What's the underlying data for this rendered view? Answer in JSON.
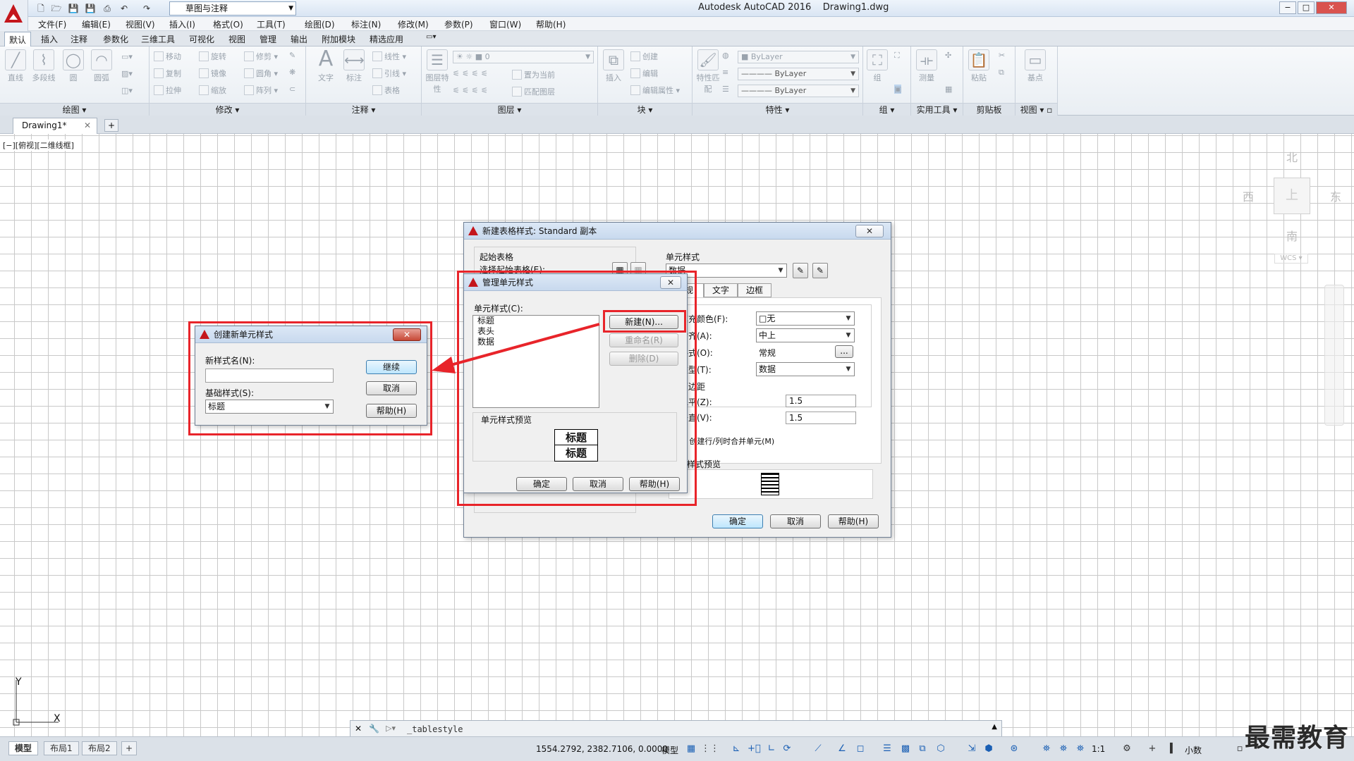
{
  "app": {
    "title": "Autodesk AutoCAD 2016",
    "filename": "Drawing1.dwg",
    "workspace": "草图与注释"
  },
  "menu": [
    "文件(F)",
    "编辑(E)",
    "视图(V)",
    "插入(I)",
    "格式(O)",
    "工具(T)",
    "绘图(D)",
    "标注(N)",
    "修改(M)",
    "参数(P)",
    "窗口(W)",
    "帮助(H)"
  ],
  "ribbon_tabs": [
    "默认",
    "插入",
    "注释",
    "参数化",
    "三维工具",
    "可视化",
    "视图",
    "管理",
    "输出",
    "附加模块",
    "精选应用"
  ],
  "ribbon": {
    "draw": {
      "label": "绘图",
      "line": "直线",
      "polyline": "多段线",
      "circle": "圆",
      "arc": "圆弧"
    },
    "modify": {
      "label": "修改",
      "move": "移动",
      "rotate": "旋转",
      "trim": "修剪",
      "copy": "复制",
      "mirror": "镜像",
      "fillet": "圆角",
      "stretch": "拉伸",
      "scale": "缩放",
      "array": "阵列"
    },
    "annotation": {
      "label": "注释",
      "text": "文字",
      "dimension": "标注",
      "linear": "线性",
      "leader": "引线",
      "table": "表格"
    },
    "layers": {
      "label": "图层",
      "layer_props": "图层特性",
      "layer_value": "0",
      "set_current": "置为当前",
      "match_layer": "匹配图层"
    },
    "block": {
      "label": "块",
      "insert": "插入",
      "create": "创建",
      "edit": "编辑",
      "edit_attr": "编辑属性"
    },
    "properties": {
      "label": "特性",
      "match": "特性匹配",
      "color": "ByLayer",
      "linetype": "ByLayer",
      "lineweight": "ByLayer"
    },
    "groups": {
      "label": "组",
      "group": "组"
    },
    "utilities": {
      "label": "实用工具",
      "measure": "测量"
    },
    "clipboard": {
      "label": "剪贴板",
      "paste": "粘贴"
    },
    "view": {
      "label": "视图",
      "base": "基点"
    }
  },
  "doc_tab": "Drawing1*",
  "view_label": "[−][俯视][二维线框]",
  "viewcube": {
    "north": "北",
    "south": "南",
    "east": "东",
    "west": "西",
    "top": "上",
    "wcs": "WCS"
  },
  "ucs": {
    "x": "X",
    "y": "Y"
  },
  "command": {
    "text": "_tablestyle"
  },
  "layout_tabs": [
    "模型",
    "布局1",
    "布局2"
  ],
  "status": {
    "coords": "1554.2792, 2382.7106, 0.0000",
    "model": "模型",
    "scale": "1:1",
    "units": "小数"
  },
  "watermark": "最需教育",
  "dlg_new_table_style": {
    "title": "新建表格样式: Standard 副本",
    "start_table": "起始表格",
    "select_start": "选择起始表格(E):",
    "cell_styles": "单元样式",
    "cell_style_value": "数据",
    "tabs": [
      "常规",
      "文字",
      "边框"
    ],
    "fill_color_label": "填充颜色(F):",
    "fill_color": "□无",
    "align_label": "对齐(A):",
    "align": "中上",
    "format_label": "格式(O):",
    "format": "常规",
    "type_label": "类型(T):",
    "type": "数据",
    "margins": "页边距",
    "h_label": "水平(Z):",
    "h_value": "1.5",
    "v_label": "垂直(V):",
    "v_value": "1.5",
    "merge": "创建行/列时合并单元(M)",
    "preview": "单元样式预览",
    "ok": "确定",
    "cancel": "取消",
    "help": "帮助(H)"
  },
  "dlg_manage_cell": {
    "title": "管理单元样式",
    "list_label": "单元样式(C):",
    "items": [
      "标题",
      "表头",
      "数据"
    ],
    "new": "新建(N)...",
    "rename": "重命名(R)",
    "delete": "删除(D)",
    "preview_label": "单元样式预览",
    "preview_cells": [
      "标题",
      "标题"
    ],
    "ok": "确定",
    "cancel": "取消",
    "help": "帮助(H)"
  },
  "dlg_create_cell": {
    "title": "创建新单元样式",
    "name_label": "新样式名(N):",
    "name_value": "",
    "base_label": "基础样式(S):",
    "base_value": "标题",
    "continue": "继续",
    "cancel": "取消",
    "help": "帮助(H)"
  },
  "colors": {
    "highlight": "#e8242a",
    "brand": "#c4161c"
  }
}
